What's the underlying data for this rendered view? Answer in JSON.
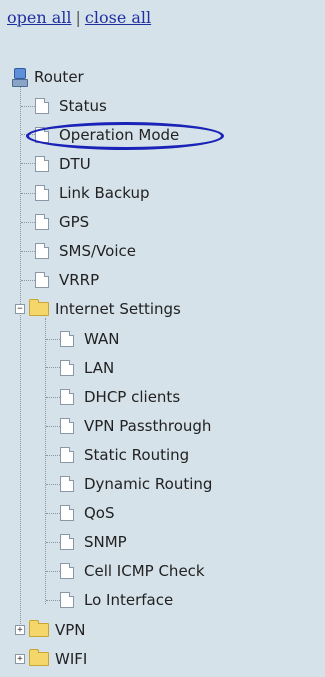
{
  "header": {
    "open_all": "open all",
    "separator": "|",
    "close_all": "close all"
  },
  "tree": {
    "root": {
      "label": "Router",
      "icon": "router-icon"
    },
    "items": [
      {
        "label": "Status"
      },
      {
        "label": "Operation Mode",
        "highlighted": true
      },
      {
        "label": "DTU"
      },
      {
        "label": "Link Backup"
      },
      {
        "label": "GPS"
      },
      {
        "label": "SMS/Voice"
      },
      {
        "label": "VRRP"
      }
    ],
    "internet_settings": {
      "label": "Internet Settings",
      "toggle": "−",
      "children": [
        {
          "label": "WAN"
        },
        {
          "label": "LAN"
        },
        {
          "label": "DHCP clients"
        },
        {
          "label": "VPN Passthrough"
        },
        {
          "label": "Static Routing"
        },
        {
          "label": "Dynamic Routing"
        },
        {
          "label": "QoS"
        },
        {
          "label": "SNMP"
        },
        {
          "label": "Cell ICMP Check"
        },
        {
          "label": "Lo Interface"
        }
      ]
    },
    "vpn": {
      "label": "VPN",
      "toggle": "+"
    },
    "wifi": {
      "label": "WIFI",
      "toggle": "+"
    }
  },
  "colors": {
    "background": "#d6e2ea",
    "link": "#1f2fa0",
    "highlight": "#1a22b8",
    "folder": "#f5d66a"
  }
}
